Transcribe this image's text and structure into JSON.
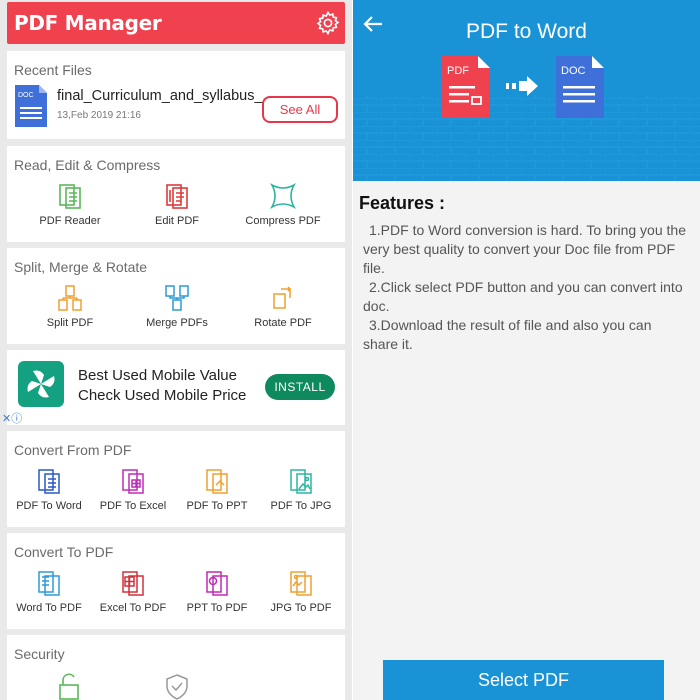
{
  "app": {
    "title": "PDF Manager"
  },
  "recent": {
    "heading": "Recent Files",
    "file_badge": "DOC",
    "file_name": "final_Curriculum_and_syllabus_..",
    "file_date": "13,Feb 2019 21:16",
    "see_all": "See All"
  },
  "read_edit": {
    "heading": "Read, Edit & Compress",
    "tools": [
      "PDF Reader",
      "Edit PDF",
      "Compress PDF"
    ]
  },
  "split_merge": {
    "heading": "Split, Merge & Rotate",
    "tools": [
      "Split PDF",
      "Merge PDFs",
      "Rotate PDF"
    ]
  },
  "ad": {
    "line1": "Best Used Mobile Value",
    "line2": "Check Used Mobile Price",
    "install": "INSTALL",
    "close_mark": "✕ⓘ"
  },
  "convert_from": {
    "heading": "Convert From PDF",
    "tools": [
      "PDF To Word",
      "PDF To Excel",
      "PDF To PPT",
      "PDF To JPG"
    ]
  },
  "convert_to": {
    "heading": "Convert To PDF",
    "tools": [
      "Word To PDF",
      "Excel To PDF",
      "PPT To PDF",
      "JPG To PDF"
    ]
  },
  "security": {
    "heading": "Security"
  },
  "detail": {
    "title": "PDF to Word",
    "from_badge": "PDF",
    "to_badge": "DOC",
    "features_title": "Features :",
    "features": [
      "1.PDF to Word conversion is hard. To bring you the very best quality to convert your Doc file from PDF file.",
      "2.Click select PDF button and you can convert into doc.",
      "3.Download the result of file and also you can share it."
    ],
    "select_button": "Select PDF"
  },
  "colors": {
    "brand_red": "#f0414f",
    "brand_blue": "#1a93d6",
    "install_green": "#0f8a5f"
  }
}
